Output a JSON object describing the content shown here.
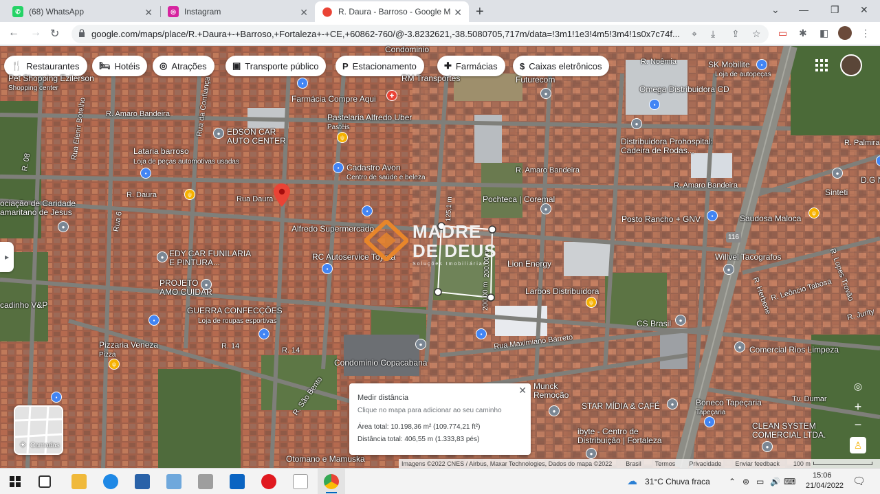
{
  "browser": {
    "tabs": [
      {
        "title": "(68) WhatsApp",
        "icon": "whatsapp-icon",
        "color": "#25d366"
      },
      {
        "title": "Instagram",
        "icon": "instagram-icon",
        "color": "#d6249f"
      },
      {
        "title": "R. Daura - Barroso - Google Map",
        "icon": "google-maps-icon",
        "color": "#ea4335"
      }
    ],
    "url": "google.com/maps/place/R.+Daura+-+Barroso,+Fortaleza+-+CE,+60862-760/@-3.8232621,-38.5080705,717m/data=!3m1!1e3!4m5!3m4!1s0x7c74f..."
  },
  "categories": [
    {
      "label": "Restaurantes",
      "icon": "fork-knife-icon",
      "glyph": "🍴"
    },
    {
      "label": "Hotéis",
      "icon": "bed-icon",
      "glyph": "🛏"
    },
    {
      "label": "Atrações",
      "icon": "camera-icon",
      "glyph": "◎"
    },
    {
      "label": "Transporte público",
      "icon": "bus-icon",
      "glyph": "▣"
    },
    {
      "label": "Estacionamento",
      "icon": "parking-icon",
      "glyph": "P"
    },
    {
      "label": "Farmácias",
      "icon": "pharmacy-icon",
      "glyph": "✚"
    },
    {
      "label": "Caixas eletrônicos",
      "icon": "atm-icon",
      "glyph": "$"
    }
  ],
  "map_labels": {
    "pet_shopping": "Pet Shopping Ezilerson",
    "shopping_center": "Shopping center",
    "condominio_top": "Condominio",
    "rm_transportes": "RM Transportes",
    "futurecom": "Futurecom",
    "r_noemia": "R. Noêmia",
    "sk_mobilite": "SK Mobilite",
    "loja_autopecas": "Loja de autopeças",
    "omega": "Omega Distribuidora CD",
    "farmacia": "Farmácia Compre Aqui",
    "r_amaro_bandeira_1": "R. Amaro Bandeira",
    "r_amaro_bandeira_2": "R. Amaro Bandeira",
    "r_amaro_bandeira_3": "R. Amaro Bandeira",
    "pastelaria": "Pastelaria Alfredo Uber",
    "pasteis": "Pastéis",
    "edson": "EDSON CAR\nAUTO CENTER",
    "distribuidora": "Distribuidora Prohospital:\nCadeira de Rodas...",
    "r_palmira": "R. Palmira",
    "lataria": "Lataria barroso",
    "lataria_sub": "Loja de peças automotivas usadas",
    "cadastro_avon": "Cadastro Avon",
    "cadastro_sub": "Centro de saúde e beleza",
    "sinteti": "Sinteti",
    "dg": "D.G N",
    "r_08": "R. 08",
    "rua_confianca": "Rua da Confiança",
    "rua_elenir": "Rua Elenir Botelho",
    "r_daura": "R. Daura",
    "rua_daura": "Rua Daura",
    "pochteca": "Pochteca | Coremal",
    "saudosa": "Saudosa Maloca",
    "r_lopes_trovao": "R. Lopes Trovão",
    "associacao": "ociação de Caridade\namaritano de Jesus",
    "r_6": "Rua 6",
    "alfredo": "Alfredo Supermercado",
    "posto": "Posto Rancho + GNV",
    "route_116": "116",
    "edy": "EDY CAR FUNILARIA\nE PINTURA...",
    "rc_auto": "RC Autoservice Toyota",
    "lion": "Lion Energy",
    "willvel": "Willvel Tacografos",
    "r_leoncio": "R. Leôncio Tabosa",
    "r_herbene": "R. Herbene",
    "projeto": "PROJETO\nAMO CUIDAR",
    "larbos": "Larbos Distribuidora",
    "r_jurity": "R. Jurity",
    "cadinho": "cadinho V&P",
    "guerra": "GUERRA CONFECÇÕES",
    "guerra_sub": "Loja de roupas esportivas",
    "cs_brasil": "CS Brasil",
    "rua_maximiano": "Rua Maximiano Barreto",
    "r_14a": "R. 14",
    "r_14b": "R. 14",
    "pizzaria": "Pizzaria Veneza",
    "pizza": "Pizza",
    "comercial_rios": "Comercial Rios Limpeza",
    "condominio_copa": "Condominio Copacabana",
    "r_sao_bento": "R. São Bento",
    "munck": "Munck\nRemoção",
    "star": "STAR MÍDIA & CAFÉ",
    "boneco": "Boneco Tapeçaria",
    "tapecaria": "Tapeçaria",
    "tv_dumar": "Tv. Dumar",
    "ibyte": "ibyte - Centro de\nDistribuição | Fortaleza",
    "clean": "CLEAN SYSTEM\nCOMERCIAL LTDA.",
    "otomano": "Otomano e Mamuska",
    "dist_125": "125,1 m",
    "dist_200a": "200,00 m",
    "dist_200b": "200,00 m"
  },
  "watermark": {
    "line1": "MADRE",
    "line2": "DE DEUS",
    "line3": "Soluções Imobiliárias"
  },
  "measure": {
    "title": "Medir distância",
    "subtitle": "Clique no mapa para adicionar ao seu caminho",
    "area": "Área total: 10.198,36 m² (109.774,21 ft²)",
    "distance": "Distância total: 406,55 m (1.333,83 pés)"
  },
  "layers_label": "Camadas",
  "attribution": {
    "imagery": "Imagens ©2022 CNES / Airbus, Maxar Technologies, Dados do mapa ©2022",
    "country": "Brasil",
    "terms": "Termos",
    "privacy": "Privacidade",
    "feedback": "Enviar feedback",
    "scale": "100 m"
  },
  "taskbar": {
    "weather": "31°C  Chuva fraca",
    "time": "15:06",
    "date": "21/04/2022"
  }
}
